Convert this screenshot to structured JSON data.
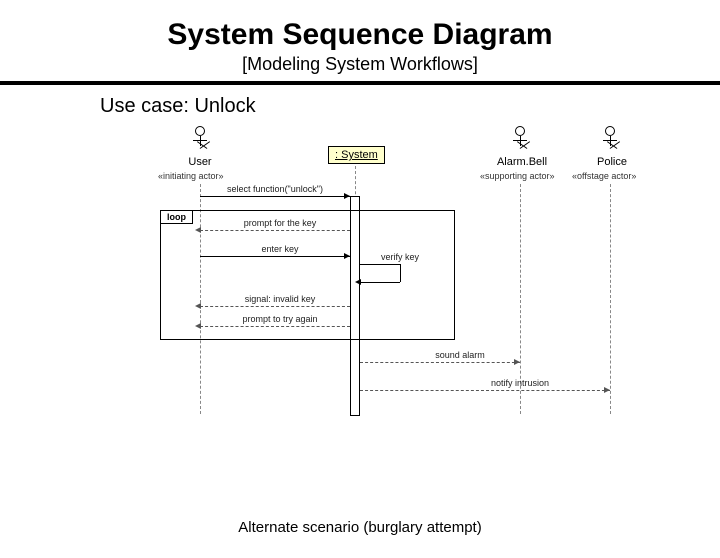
{
  "title": "System Sequence Diagram",
  "subtitle": "[Modeling System Workflows]",
  "usecase": "Use case: Unlock",
  "actors": {
    "user": {
      "label": "User",
      "stereo": "«initiating actor»"
    },
    "system": {
      "label": ": System"
    },
    "alarm": {
      "label": "Alarm.Bell",
      "stereo": "«supporting actor»"
    },
    "police": {
      "label": "Police",
      "stereo": "«offstage actor»"
    }
  },
  "messages": {
    "m1": "select function(\"unlock\")",
    "m2": "prompt for the key",
    "m3": "enter key",
    "m4": "verify key",
    "m5": "signal: invalid key",
    "m6": "prompt to try again",
    "m7": "sound alarm",
    "m8": "notify intrusion"
  },
  "loop_label": "loop",
  "footer": "Alternate scenario (burglary attempt)"
}
